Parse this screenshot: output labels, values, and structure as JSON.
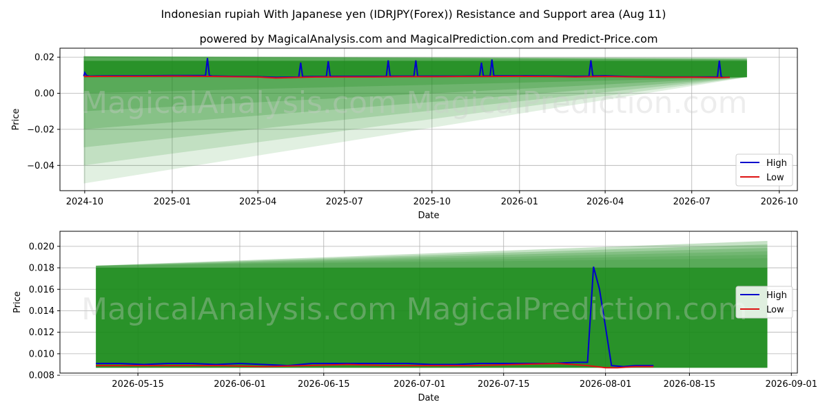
{
  "title": "Indonesian rupiah With Japanese yen (IDRJPY(Forex)) Resistance and Support area (Aug 11)",
  "subtitle": "powered by MagicalAnalysis.com and MagicalPrediction.com and Predict-Price.com",
  "watermarks": [
    "MagicalAnalysis.com",
    "MagicalPrediction.com"
  ],
  "colors": {
    "high": "#0000cc",
    "low": "#dd1111",
    "band": "#1a8a1a"
  },
  "chart_data": [
    {
      "type": "line",
      "xlabel": "Date",
      "ylabel": "Price",
      "xlim": [
        "2024-09-05",
        "2026-10-20"
      ],
      "ylim": [
        -0.054,
        0.025
      ],
      "x_ticks": [
        "2024-10",
        "2025-01",
        "2025-04",
        "2025-07",
        "2025-10",
        "2026-01",
        "2026-04",
        "2026-07",
        "2026-10"
      ],
      "y_ticks": [
        "0.02",
        "0.00",
        "−0.02",
        "−0.04"
      ],
      "y_tick_values": [
        0.02,
        0.0,
        -0.02,
        -0.04
      ],
      "legend": {
        "position": "lower-right",
        "entries": [
          "High",
          "Low"
        ]
      },
      "band": {
        "start": "2024-09-30",
        "end": "2026-08-28",
        "resistance": [
          0.0205,
          0.0185
        ],
        "support": [
          -0.05,
          0.0089
        ]
      },
      "series": [
        {
          "name": "High",
          "x": [
            "2024-09-30",
            "2024-10-01",
            "2024-10-03",
            "2024-10-06",
            "2024-10-15",
            "2024-11-01",
            "2024-12-01",
            "2025-01-01",
            "2025-02-05",
            "2025-02-07",
            "2025-02-09",
            "2025-02-12",
            "2025-03-01",
            "2025-04-01",
            "2025-04-20",
            "2025-05-14",
            "2025-05-16",
            "2025-05-18",
            "2025-06-01",
            "2025-06-12",
            "2025-06-14",
            "2025-06-16",
            "2025-07-01",
            "2025-08-01",
            "2025-08-14",
            "2025-08-16",
            "2025-08-18",
            "2025-09-01",
            "2025-09-12",
            "2025-09-14",
            "2025-09-16",
            "2025-10-01",
            "2025-11-01",
            "2025-11-20",
            "2025-11-22",
            "2025-11-24",
            "2025-12-01",
            "2025-12-03",
            "2025-12-05",
            "2026-01-01",
            "2026-02-01",
            "2026-03-01",
            "2026-03-15",
            "2026-03-17",
            "2026-03-19",
            "2026-04-01",
            "2026-05-01",
            "2026-06-01",
            "2026-07-01",
            "2026-07-28",
            "2026-07-30",
            "2026-08-01",
            "2026-08-03",
            "2026-08-10"
          ],
          "values": [
            0.0095,
            0.0115,
            0.0098,
            0.0095,
            0.0096,
            0.0097,
            0.0097,
            0.0098,
            0.0098,
            0.0195,
            0.0098,
            0.0096,
            0.0094,
            0.0092,
            0.0088,
            0.009,
            0.017,
            0.0092,
            0.0093,
            0.0093,
            0.0178,
            0.0094,
            0.0094,
            0.0094,
            0.0094,
            0.0182,
            0.0095,
            0.0095,
            0.0095,
            0.0182,
            0.0095,
            0.0095,
            0.0095,
            0.0096,
            0.017,
            0.0096,
            0.0096,
            0.0187,
            0.0097,
            0.0097,
            0.0096,
            0.0094,
            0.0095,
            0.0183,
            0.0096,
            0.0097,
            0.0092,
            0.009,
            0.009,
            0.0091,
            0.0181,
            0.0092,
            0.0088,
            0.0089
          ]
        },
        {
          "name": "Low",
          "x": [
            "2024-09-30",
            "2024-11-01",
            "2024-12-01",
            "2025-01-01",
            "2025-02-01",
            "2025-03-01",
            "2025-04-01",
            "2025-04-20",
            "2025-05-15",
            "2025-06-01",
            "2025-07-01",
            "2025-08-01",
            "2025-09-01",
            "2025-10-01",
            "2025-11-01",
            "2025-12-01",
            "2026-01-01",
            "2026-02-01",
            "2026-03-01",
            "2026-04-01",
            "2026-05-01",
            "2026-06-01",
            "2026-07-01",
            "2026-08-01",
            "2026-08-10"
          ],
          "values": [
            0.0093,
            0.0094,
            0.0094,
            0.0095,
            0.0094,
            0.0092,
            0.009,
            0.0085,
            0.0088,
            0.009,
            0.0091,
            0.0091,
            0.0092,
            0.0092,
            0.0093,
            0.0093,
            0.0094,
            0.0093,
            0.0091,
            0.0093,
            0.0091,
            0.0089,
            0.0089,
            0.0087,
            0.0088
          ]
        }
      ]
    },
    {
      "type": "line",
      "xlabel": "Date",
      "ylabel": "Price",
      "xlim": [
        "2026-05-02",
        "2026-09-02"
      ],
      "ylim": [
        0.0082,
        0.0214
      ],
      "x_ticks": [
        "2026-05-15",
        "2026-06-01",
        "2026-06-15",
        "2026-07-01",
        "2026-07-15",
        "2026-08-01",
        "2026-08-15",
        "2026-09-01"
      ],
      "y_ticks": [
        "0.020",
        "0.018",
        "0.016",
        "0.014",
        "0.012",
        "0.010",
        "0.008"
      ],
      "y_tick_values": [
        0.02,
        0.018,
        0.016,
        0.014,
        0.012,
        0.01,
        0.008
      ],
      "legend": {
        "position": "center-right",
        "entries": [
          "High",
          "Low"
        ]
      },
      "band": {
        "start": "2026-05-08",
        "end": "2026-08-28",
        "resistance": [
          0.0182,
          0.0205
        ],
        "support": [
          0.0087,
          0.0087
        ]
      },
      "series": [
        {
          "name": "High",
          "x": [
            "2026-05-08",
            "2026-05-12",
            "2026-05-16",
            "2026-05-20",
            "2026-05-24",
            "2026-05-28",
            "2026-06-01",
            "2026-06-05",
            "2026-06-09",
            "2026-06-13",
            "2026-06-17",
            "2026-06-21",
            "2026-06-25",
            "2026-06-29",
            "2026-07-03",
            "2026-07-07",
            "2026-07-11",
            "2026-07-15",
            "2026-07-19",
            "2026-07-23",
            "2026-07-27",
            "2026-07-29",
            "2026-07-30",
            "2026-07-31",
            "2026-08-01",
            "2026-08-02",
            "2026-08-04",
            "2026-08-06",
            "2026-08-09"
          ],
          "values": [
            0.0091,
            0.0091,
            0.009,
            0.0091,
            0.0091,
            0.009,
            0.0091,
            0.009,
            0.0089,
            0.0091,
            0.0091,
            0.0091,
            0.0091,
            0.0091,
            0.009,
            0.009,
            0.0091,
            0.0091,
            0.0091,
            0.0091,
            0.0092,
            0.0092,
            0.0181,
            0.016,
            0.0125,
            0.0089,
            0.0088,
            0.0089,
            0.0089
          ]
        },
        {
          "name": "Low",
          "x": [
            "2026-05-08",
            "2026-05-15",
            "2026-05-22",
            "2026-05-29",
            "2026-06-05",
            "2026-06-12",
            "2026-06-19",
            "2026-06-26",
            "2026-07-03",
            "2026-07-10",
            "2026-07-17",
            "2026-07-24",
            "2026-07-29",
            "2026-08-01",
            "2026-08-03",
            "2026-08-06",
            "2026-08-09"
          ],
          "values": [
            0.0089,
            0.0089,
            0.0089,
            0.0089,
            0.0088,
            0.0089,
            0.009,
            0.0089,
            0.0089,
            0.0089,
            0.009,
            0.0091,
            0.0089,
            0.0087,
            0.0087,
            0.0088,
            0.0088
          ]
        }
      ]
    }
  ]
}
